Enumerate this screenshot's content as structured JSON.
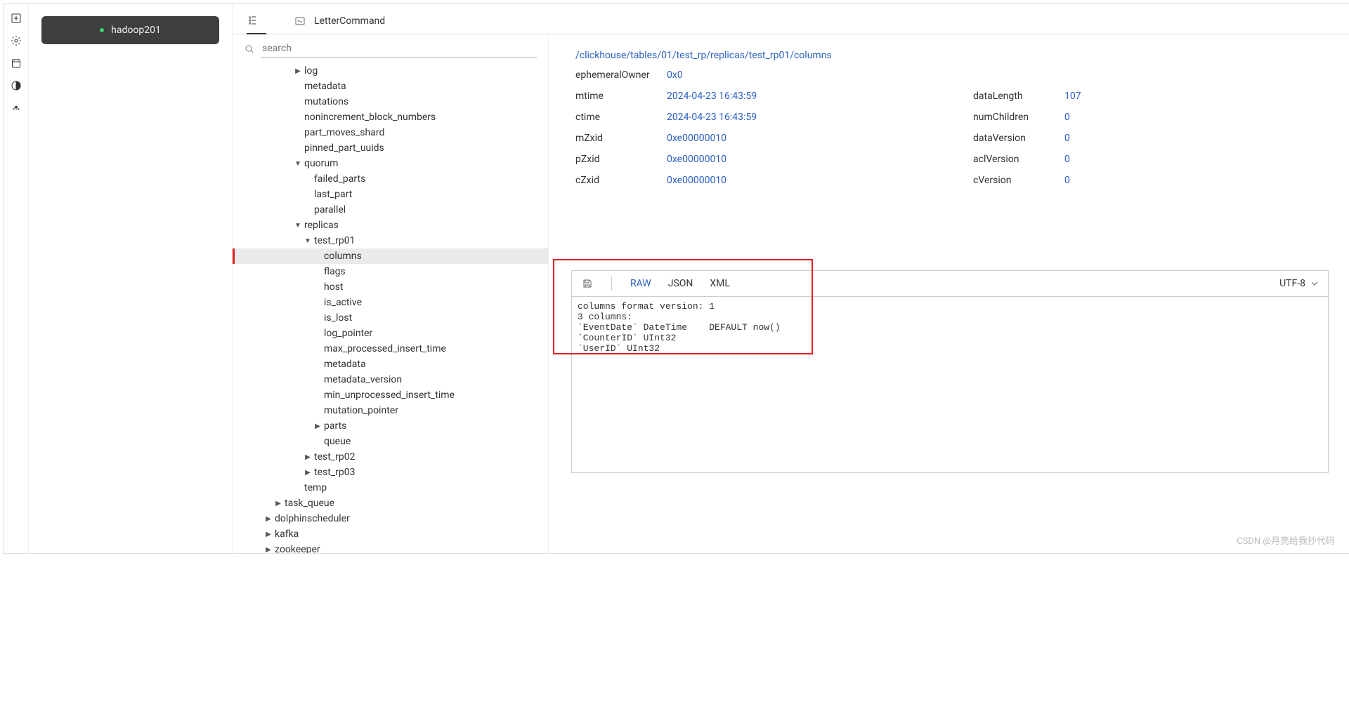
{
  "sidebar": {
    "node_label": "hadoop201"
  },
  "tabs": {
    "tree_tab": "",
    "letter_tab": "LetterCommand"
  },
  "search": {
    "placeholder": "search"
  },
  "tree": {
    "items": [
      {
        "d": 4,
        "t": "▶",
        "l": "log"
      },
      {
        "d": 4,
        "t": "",
        "l": "metadata"
      },
      {
        "d": 4,
        "t": "",
        "l": "mutations"
      },
      {
        "d": 4,
        "t": "",
        "l": "nonincrement_block_numbers"
      },
      {
        "d": 4,
        "t": "",
        "l": "part_moves_shard"
      },
      {
        "d": 4,
        "t": "",
        "l": "pinned_part_uuids"
      },
      {
        "d": 4,
        "t": "▼",
        "l": "quorum"
      },
      {
        "d": 5,
        "t": "",
        "l": "failed_parts"
      },
      {
        "d": 5,
        "t": "",
        "l": "last_part"
      },
      {
        "d": 5,
        "t": "",
        "l": "parallel"
      },
      {
        "d": 4,
        "t": "▼",
        "l": "replicas"
      },
      {
        "d": 5,
        "t": "▼",
        "l": "test_rp01"
      },
      {
        "d": 6,
        "t": "",
        "l": "columns",
        "sel": true
      },
      {
        "d": 6,
        "t": "",
        "l": "flags"
      },
      {
        "d": 6,
        "t": "",
        "l": "host"
      },
      {
        "d": 6,
        "t": "",
        "l": "is_active"
      },
      {
        "d": 6,
        "t": "",
        "l": "is_lost"
      },
      {
        "d": 6,
        "t": "",
        "l": "log_pointer"
      },
      {
        "d": 6,
        "t": "",
        "l": "max_processed_insert_time"
      },
      {
        "d": 6,
        "t": "",
        "l": "metadata"
      },
      {
        "d": 6,
        "t": "",
        "l": "metadata_version"
      },
      {
        "d": 6,
        "t": "",
        "l": "min_unprocessed_insert_time"
      },
      {
        "d": 6,
        "t": "",
        "l": "mutation_pointer"
      },
      {
        "d": 6,
        "t": "▶",
        "l": "parts"
      },
      {
        "d": 6,
        "t": "",
        "l": "queue"
      },
      {
        "d": 5,
        "t": "▶",
        "l": "test_rp02"
      },
      {
        "d": 5,
        "t": "▶",
        "l": "test_rp03"
      },
      {
        "d": 4,
        "t": "",
        "l": "temp"
      },
      {
        "d": 2,
        "t": "▶",
        "l": "task_queue"
      },
      {
        "d": 1,
        "t": "▶",
        "l": "dolphinscheduler"
      },
      {
        "d": 1,
        "t": "▶",
        "l": "kafka"
      },
      {
        "d": 1,
        "t": "▶",
        "l": "zookeeper"
      }
    ]
  },
  "detail": {
    "path": "/clickhouse/tables/01/test_rp/replicas/test_rp01/columns",
    "meta_left": [
      {
        "k": "ephemeralOwner",
        "v": "0x0"
      },
      {
        "k": "mtime",
        "v": "2024-04-23 16:43:59"
      },
      {
        "k": "ctime",
        "v": "2024-04-23 16:43:59"
      },
      {
        "k": "mZxid",
        "v": "0xe00000010"
      },
      {
        "k": "pZxid",
        "v": "0xe00000010"
      },
      {
        "k": "cZxid",
        "v": "0xe00000010"
      }
    ],
    "meta_right": [
      {
        "k": "",
        "v": ""
      },
      {
        "k": "dataLength",
        "v": "107"
      },
      {
        "k": "numChildren",
        "v": "0"
      },
      {
        "k": "dataVersion",
        "v": "0"
      },
      {
        "k": "aclVersion",
        "v": "0"
      },
      {
        "k": "cVersion",
        "v": "0"
      }
    ],
    "formats": {
      "raw": "RAW",
      "json": "JSON",
      "xml": "XML"
    },
    "encoding": "UTF-8",
    "content": "columns format version: 1\n3 columns:\n`EventDate` DateTime    DEFAULT now()\n`CounterID` UInt32\n`UserID` UInt32"
  },
  "watermark": "CSDN @月亮给我抄代码"
}
